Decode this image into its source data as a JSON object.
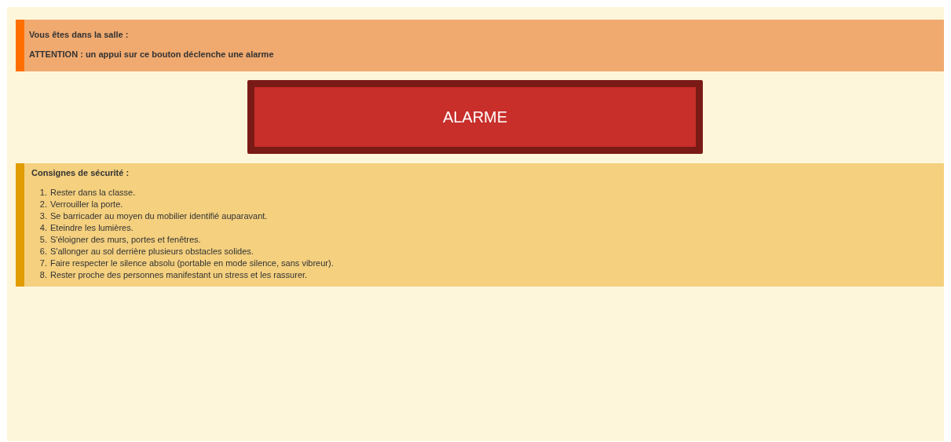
{
  "notice": {
    "room_label": "Vous êtes dans la salle :",
    "warning": "ATTENTION : un appui sur ce bouton déclenche une alarme"
  },
  "alarm_button": {
    "label": "ALARME"
  },
  "safety": {
    "title": "Consignes de sécurité :",
    "items": [
      {
        "number": "1.",
        "text": "Rester dans la classe."
      },
      {
        "number": "2.",
        "text": "Verrouiller la porte."
      },
      {
        "number": "3.",
        "text": "Se barricader au moyen du mobilier identifié auparavant."
      },
      {
        "number": "4.",
        "text": "Eteindre les lumières."
      },
      {
        "number": "5.",
        "text": "S'éloigner des murs, portes et fenêtres."
      },
      {
        "number": "6.",
        "text": "S'allonger au sol derrière plusieurs obstacles solides."
      },
      {
        "number": "7.",
        "text": "Faire respecter le silence absolu (portable en mode silence, sans vibreur)."
      },
      {
        "number": "8.",
        "text": "Rester proche des personnes manifestant un stress et les rassurer."
      }
    ]
  }
}
